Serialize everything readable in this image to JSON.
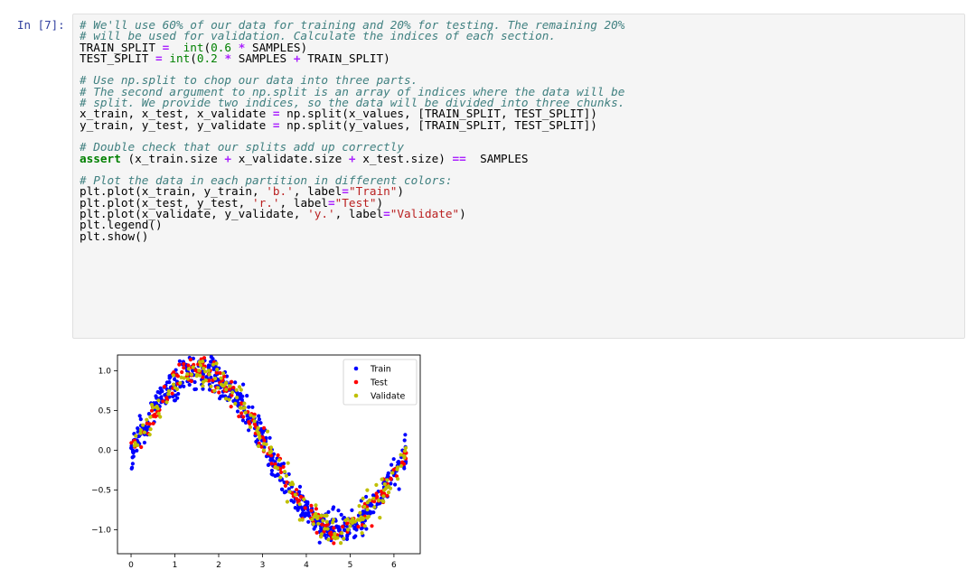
{
  "prompt": "In [7]:",
  "code": [
    [
      {
        "t": "# We'll use 60% of our data for training and 20% for testing. The remaining 20%",
        "c": "cm"
      }
    ],
    [
      {
        "t": "# will be used for validation. Calculate the indices of each section.",
        "c": "cm"
      }
    ],
    [
      {
        "t": "TRAIN_SPLIT ",
        "c": ""
      },
      {
        "t": "=",
        "c": "op"
      },
      {
        "t": "  ",
        "c": ""
      },
      {
        "t": "int",
        "c": "nb"
      },
      {
        "t": "(",
        "c": ""
      },
      {
        "t": "0.6",
        "c": "num"
      },
      {
        "t": " ",
        "c": ""
      },
      {
        "t": "*",
        "c": "op"
      },
      {
        "t": " SAMPLES)",
        "c": ""
      }
    ],
    [
      {
        "t": "TEST_SPLIT ",
        "c": ""
      },
      {
        "t": "=",
        "c": "op"
      },
      {
        "t": " ",
        "c": ""
      },
      {
        "t": "int",
        "c": "nb"
      },
      {
        "t": "(",
        "c": ""
      },
      {
        "t": "0.2",
        "c": "num"
      },
      {
        "t": " ",
        "c": ""
      },
      {
        "t": "*",
        "c": "op"
      },
      {
        "t": " SAMPLES ",
        "c": ""
      },
      {
        "t": "+",
        "c": "op"
      },
      {
        "t": " TRAIN_SPLIT)",
        "c": ""
      }
    ],
    [],
    [
      {
        "t": "# Use np.split to chop our data into three parts.",
        "c": "cm"
      }
    ],
    [
      {
        "t": "# The second argument to np.split is an array of indices where the data will be",
        "c": "cm"
      }
    ],
    [
      {
        "t": "# split. We provide two indices, so the data will be divided into three chunks.",
        "c": "cm"
      }
    ],
    [
      {
        "t": "x_train, x_test, x_validate ",
        "c": ""
      },
      {
        "t": "=",
        "c": "op"
      },
      {
        "t": " np.split(x_values, [TRAIN_SPLIT, TEST_SPLIT])",
        "c": ""
      }
    ],
    [
      {
        "t": "y_train, y_test, y_validate ",
        "c": ""
      },
      {
        "t": "=",
        "c": "op"
      },
      {
        "t": " np.split(y_values, [TRAIN_SPLIT, TEST_SPLIT])",
        "c": ""
      }
    ],
    [],
    [
      {
        "t": "# Double check that our splits add up correctly",
        "c": "cm"
      }
    ],
    [
      {
        "t": "assert",
        "c": "kw"
      },
      {
        "t": " (x_train.size ",
        "c": ""
      },
      {
        "t": "+",
        "c": "op"
      },
      {
        "t": " x_validate.size ",
        "c": ""
      },
      {
        "t": "+",
        "c": "op"
      },
      {
        "t": " x_test.size) ",
        "c": ""
      },
      {
        "t": "==",
        "c": "op"
      },
      {
        "t": "  SAMPLES",
        "c": ""
      }
    ],
    [],
    [
      {
        "t": "# Plot the data in each partition in different colors:",
        "c": "cm"
      }
    ],
    [
      {
        "t": "plt.plot(x_train, y_train, ",
        "c": ""
      },
      {
        "t": "'b.'",
        "c": "str"
      },
      {
        "t": ", label",
        "c": ""
      },
      {
        "t": "=",
        "c": "op"
      },
      {
        "t": "\"Train\"",
        "c": "str"
      },
      {
        "t": ")",
        "c": ""
      }
    ],
    [
      {
        "t": "plt.plot(x_test, y_test, ",
        "c": ""
      },
      {
        "t": "'r.'",
        "c": "str"
      },
      {
        "t": ", label",
        "c": ""
      },
      {
        "t": "=",
        "c": "op"
      },
      {
        "t": "\"Test\"",
        "c": "str"
      },
      {
        "t": ")",
        "c": ""
      }
    ],
    [
      {
        "t": "plt.plot(x_validate, y_validate, ",
        "c": ""
      },
      {
        "t": "'y.'",
        "c": "str"
      },
      {
        "t": ", label",
        "c": ""
      },
      {
        "t": "=",
        "c": "op"
      },
      {
        "t": "\"Validate\"",
        "c": "str"
      },
      {
        "t": ")",
        "c": ""
      }
    ],
    [
      {
        "t": "plt.legend()",
        "c": ""
      }
    ],
    [
      {
        "t": "plt.show()",
        "c": ""
      }
    ]
  ],
  "chart_data": {
    "type": "scatter",
    "xlim": [
      -0.31,
      6.6
    ],
    "ylim": [
      -1.3,
      1.2
    ],
    "xticks": [
      "0",
      "1",
      "2",
      "3",
      "4",
      "5",
      "6"
    ],
    "yticks": [
      "1.0",
      "0.5",
      "0.0",
      "−0.5",
      "−1.0"
    ],
    "ytick_values": [
      1.0,
      0.5,
      0.0,
      -0.5,
      -1.0
    ],
    "xtick_values": [
      0,
      1,
      2,
      3,
      4,
      5,
      6
    ],
    "function": "sin(x) + noise",
    "x_range": [
      0,
      6.28
    ],
    "noise": 0.1,
    "legend_position": "upper right",
    "series": [
      {
        "name": "Train",
        "color": "#0000ff",
        "count": 600
      },
      {
        "name": "Test",
        "color": "#ff0000",
        "count": 200
      },
      {
        "name": "Validate",
        "color": "#bfbf00",
        "count": 200
      }
    ]
  }
}
